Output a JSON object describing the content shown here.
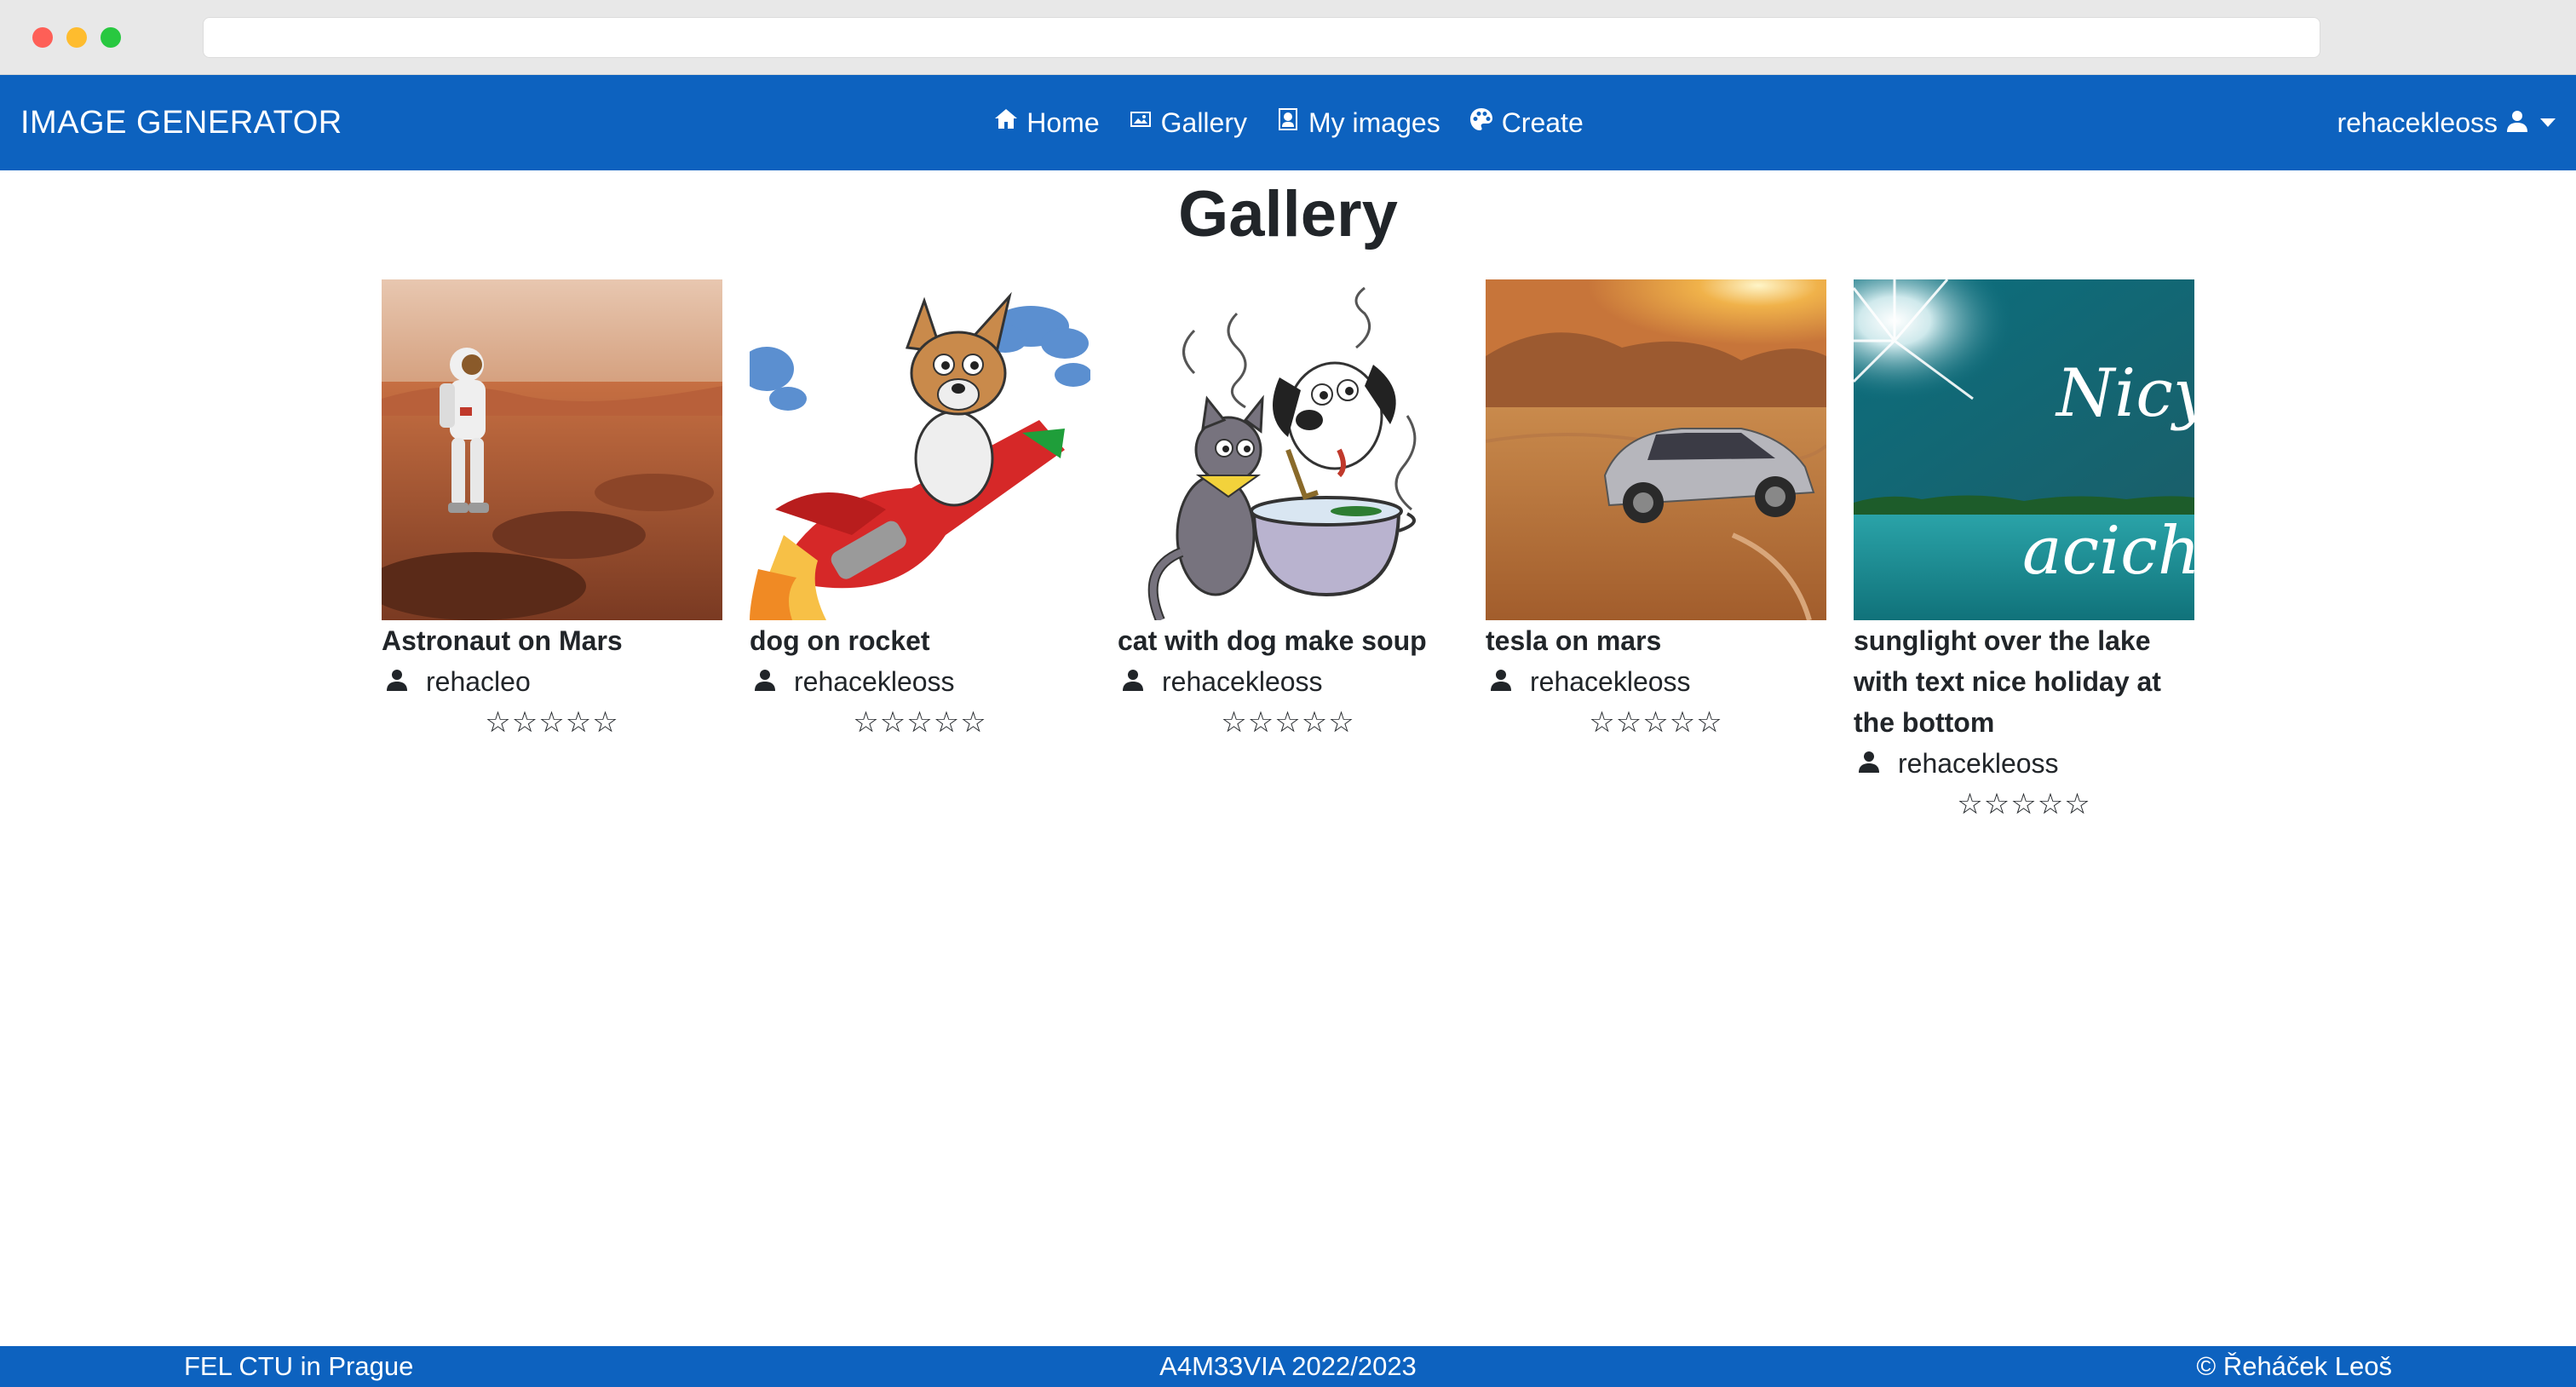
{
  "navbar": {
    "brand": "IMAGE GENERATOR",
    "links": [
      {
        "label": "Home",
        "icon": "home-icon"
      },
      {
        "label": "Gallery",
        "icon": "images-icon"
      },
      {
        "label": "My images",
        "icon": "portrait-icon"
      },
      {
        "label": "Create",
        "icon": "palette-icon"
      }
    ],
    "user": "rehacekleoss",
    "accent_color": "#0d62bf"
  },
  "page": {
    "title": "Gallery"
  },
  "gallery": {
    "cards": [
      {
        "title": "Astronaut on Mars",
        "author": "rehacleo",
        "rating": "☆☆☆☆☆"
      },
      {
        "title": "dog on rocket",
        "author": "rehacekleoss",
        "rating": "☆☆☆☆☆"
      },
      {
        "title": "cat with dog make soup",
        "author": "rehacekleoss",
        "rating": "☆☆☆☆☆"
      },
      {
        "title": "tesla on mars",
        "author": "rehacekleoss",
        "rating": "☆☆☆☆☆"
      },
      {
        "title": "sunglight over the lake with text nice holiday at the bottom",
        "author": "rehacekleoss",
        "rating": "☆☆☆☆☆",
        "image_text": [
          "Nicy",
          "acich"
        ]
      }
    ]
  },
  "footer": {
    "left": "FEL CTU in Prague",
    "center": "A4M33VIA 2022/2023",
    "right": "© Řeháček Leoš"
  }
}
